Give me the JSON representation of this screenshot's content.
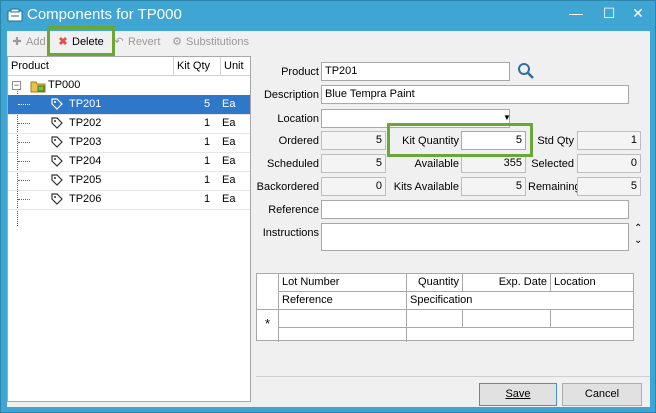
{
  "window": {
    "title": "Components for TP000"
  },
  "toolbar": {
    "add_label": "Add",
    "delete_label": "Delete",
    "revert_label": "Revert",
    "substitutions_label": "Substitutions"
  },
  "tree": {
    "columns": [
      "Product",
      "Kit Qty",
      "Unit"
    ],
    "root": {
      "label": "TP000"
    },
    "items": [
      {
        "product": "TP201",
        "qty": "5",
        "unit": "Ea"
      },
      {
        "product": "TP202",
        "qty": "1",
        "unit": "Ea"
      },
      {
        "product": "TP203",
        "qty": "1",
        "unit": "Ea"
      },
      {
        "product": "TP204",
        "qty": "1",
        "unit": "Ea"
      },
      {
        "product": "TP205",
        "qty": "1",
        "unit": "Ea"
      },
      {
        "product": "TP206",
        "qty": "1",
        "unit": "Ea"
      }
    ]
  },
  "form": {
    "product_label": "Product",
    "product_value": "TP201",
    "description_label": "Description",
    "description_value": "Blue Tempra Paint",
    "location_label": "Location",
    "location_value": "",
    "ordered_label": "Ordered",
    "ordered_value": "5",
    "kit_quantity_label": "Kit Quantity",
    "kit_quantity_value": "5",
    "std_qty_label": "Std Qty",
    "std_qty_value": "1",
    "scheduled_label": "Scheduled",
    "scheduled_value": "5",
    "available_label": "Available",
    "available_value": "355",
    "selected_label": "Selected",
    "selected_value": "0",
    "backordered_label": "Backordered",
    "backordered_value": "0",
    "kits_available_label": "Kits Available",
    "kits_available_value": "5",
    "remaining_label": "Remaining",
    "remaining_value": "5",
    "reference_label": "Reference",
    "reference_value": "",
    "instructions_label": "Instructions",
    "instructions_value": ""
  },
  "lot_grid": {
    "header1": [
      "Lot Number",
      "Quantity",
      "Exp. Date",
      "Location"
    ],
    "header2": [
      "Reference",
      "Specification"
    ],
    "new_row_marker": "*"
  },
  "buttons": {
    "save_label": "Save",
    "cancel_label": "Cancel"
  },
  "colors": {
    "titlebar": "#3fa6d4",
    "selection": "#2f78c9",
    "highlight_box": "#6aa737",
    "delete_icon": "#e05050"
  }
}
